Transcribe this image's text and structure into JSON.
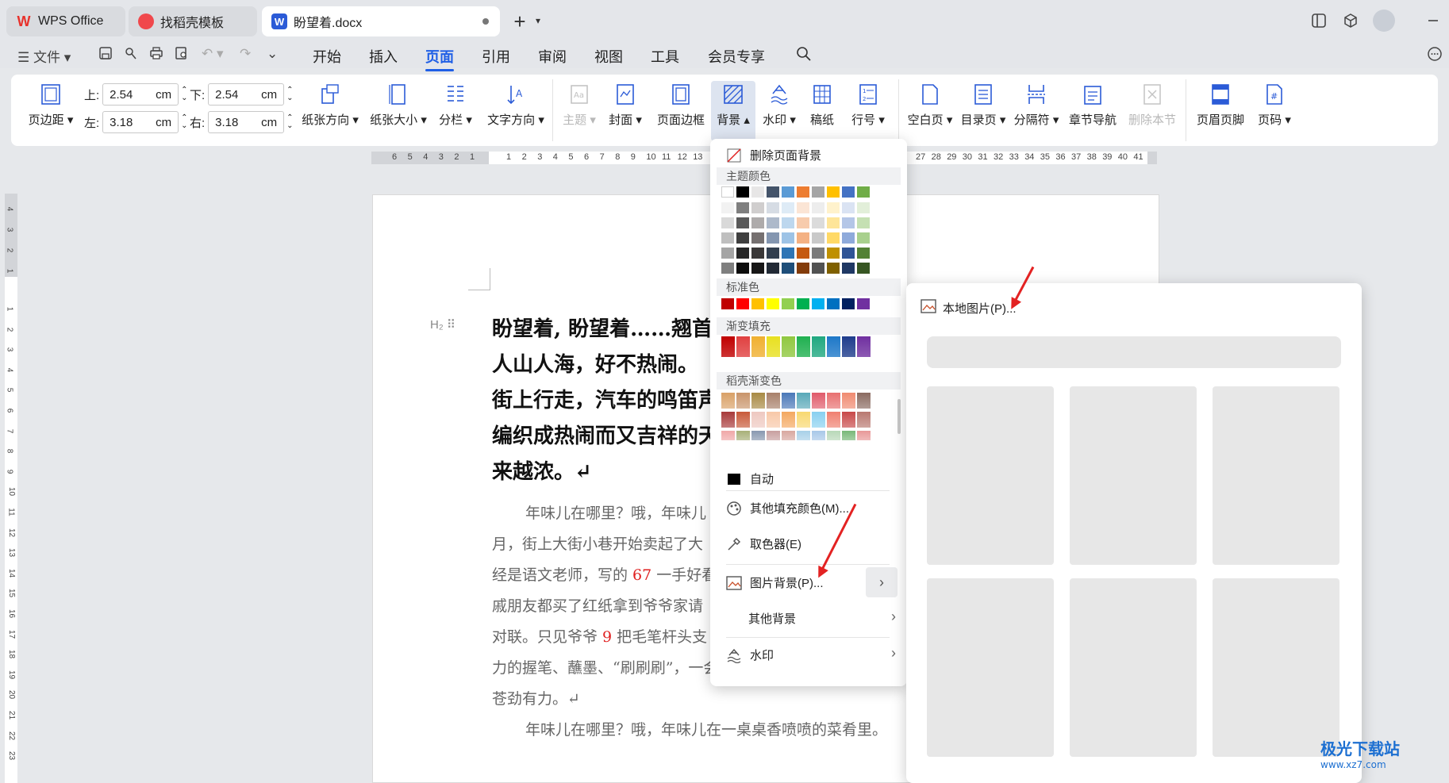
{
  "tabs": [
    {
      "label": "WPS Office",
      "icon": "wps-logo-icon"
    },
    {
      "label": "找稻壳模板",
      "icon": "docer-icon"
    },
    {
      "label": "盼望着.docx",
      "icon": "word-doc-icon"
    }
  ],
  "new_tab_label": "+",
  "menubar": {
    "file_label": "文件",
    "items": [
      "开始",
      "插入",
      "页面",
      "引用",
      "审阅",
      "视图",
      "工具",
      "会员专享"
    ],
    "active": "页面"
  },
  "ribbon": {
    "margins_label": "页边距",
    "top_label": "上:",
    "top_value": "2.54",
    "top_unit": "cm",
    "bottom_label": "下:",
    "bottom_value": "2.54",
    "bottom_unit": "cm",
    "left_label": "左:",
    "left_value": "3.18",
    "left_unit": "cm",
    "right_label": "右:",
    "right_value": "3.18",
    "right_unit": "cm",
    "orientation": "纸张方向",
    "paper_size": "纸张大小",
    "columns": "分栏",
    "text_direction": "文字方向",
    "theme": "主题",
    "cover": "封面",
    "page_border": "页面边框",
    "background": "背景",
    "watermark": "水印",
    "manuscript": "稿纸",
    "line_number": "行号",
    "blank_page": "空白页",
    "toc_page": "目录页",
    "separator": "分隔符",
    "section_nav": "章节导航",
    "delete_section": "删除本节",
    "header_footer": "页眉页脚",
    "page_number": "页码"
  },
  "ruler": {
    "h_gray_left": [
      "6",
      "5",
      "4",
      "3",
      "2",
      "1"
    ],
    "h_white": [
      "1",
      "2",
      "3",
      "4",
      "5",
      "6",
      "7",
      "8",
      "9",
      "10",
      "11",
      "12",
      "13"
    ],
    "h_right": [
      "27",
      "28",
      "29",
      "30",
      "31",
      "32",
      "33",
      "34",
      "35",
      "36",
      "37",
      "38",
      "39",
      "40",
      "41"
    ],
    "v_top": [
      "4",
      "3",
      "2",
      "1"
    ],
    "v_main": [
      "1",
      "2",
      "3",
      "4",
      "5",
      "6",
      "7",
      "8",
      "9",
      "10",
      "11",
      "12",
      "13",
      "14",
      "15",
      "16",
      "17",
      "18",
      "19",
      "20",
      "21",
      "22",
      "23"
    ]
  },
  "document": {
    "heading_lines": [
      "盼望着, 盼望着……翘首",
      "人山人海，好不热闹。",
      "街上行走，汽车的鸣笛声",
      "编织成热闹而又吉祥的天",
      "来越浓。↵"
    ],
    "body_lines": [
      {
        "text": "年味儿在哪里？哦，年味儿",
        "indent": true
      },
      {
        "text": "月，街上大街小巷开始卖起了大",
        "indent": false
      },
      {
        "pre": "经是语文老师，写的 ",
        "num": "67",
        "post": " 一手好看",
        "indent": false
      },
      {
        "text": "戚朋友都买了红纸拿到爷爷家请",
        "indent": false
      },
      {
        "pre": "对联。只见爷爷 ",
        "num": "9",
        "post": " 把毛笔杆头支",
        "indent": false
      },
      {
        "text": "力的握笔、蘸墨、“刷刷刷”，一会儿下功夫，一副副对联",
        "indent": false
      },
      {
        "text": "苍劲有力。↵",
        "indent": false
      },
      {
        "text": "年味儿在哪里？哦，年味儿在一桌桌香喷喷的菜肴里。",
        "indent": true
      }
    ]
  },
  "background_menu": {
    "delete_bg": "删除页面背景",
    "theme_colors": "主题颜色",
    "standard_colors": "标准色",
    "gradient_fill": "渐变填充",
    "docer_gradient": "稻壳渐变色",
    "auto": "自动",
    "more_colors": "其他填充颜色(M)...",
    "eyedropper": "取色器(E)",
    "picture_bg": "图片背景(P)...",
    "other_bg": "其他背景",
    "watermark": "水印"
  },
  "submenu": {
    "local_picture": "本地图片(P)..."
  },
  "colors": {
    "theme_top": [
      "#ffffff",
      "#000000",
      "#e7e6e6",
      "#44546a",
      "#5b9bd5",
      "#ed7d31",
      "#a5a5a5",
      "#ffc000",
      "#4472c4",
      "#70ad47"
    ],
    "theme_shades": [
      [
        "#f2f2f2",
        "#7f7f7f",
        "#d0cece",
        "#d6dce4",
        "#deebf6",
        "#fbe5d5",
        "#ededed",
        "#fff2cc",
        "#dae3f3",
        "#e2efd9"
      ],
      [
        "#d9d9d9",
        "#595959",
        "#aeabab",
        "#adb9ca",
        "#bdd7ee",
        "#f7cbac",
        "#dbdbdb",
        "#fee599",
        "#b4c6e7",
        "#c5e0b3"
      ],
      [
        "#bfbfbf",
        "#3f3f3f",
        "#757070",
        "#8496b0",
        "#9dc3e6",
        "#f4b183",
        "#c9c9c9",
        "#ffd966",
        "#8eaadb",
        "#a8d08d"
      ],
      [
        "#a5a5a5",
        "#262626",
        "#3a3838",
        "#323f4f",
        "#2e75b5",
        "#c55a11",
        "#7b7b7b",
        "#bf9000",
        "#2f5496",
        "#538135"
      ],
      [
        "#7f7f7f",
        "#0c0c0c",
        "#171616",
        "#222a35",
        "#1e4e79",
        "#833c0b",
        "#525252",
        "#7f6000",
        "#1f3864",
        "#375623"
      ]
    ],
    "standard": [
      "#c00000",
      "#ff0000",
      "#ffc000",
      "#ffff00",
      "#92d050",
      "#00b050",
      "#00b0f0",
      "#0070c0",
      "#002060",
      "#7030a0"
    ],
    "gradient": [
      "#c00000",
      "#e04040",
      "#f0b030",
      "#e8e020",
      "#90c840",
      "#20b050",
      "#20a880",
      "#1e78c8",
      "#1e3c8c",
      "#7030a0"
    ],
    "docer": [
      [
        "#d9a066",
        "#c9946a",
        "#a88a44",
        "#a8806a",
        "#4a78b8",
        "#58a8b8",
        "#e05a6a",
        "#e87070",
        "#f08a70",
        "#8a6a60"
      ],
      [
        "#a83a3a",
        "#c85a3a",
        "#eec8c0",
        "#f8c8a8",
        "#f4a860",
        "#f8d870",
        "#88d0f0",
        "#f08070",
        "#c84848",
        "#b87870"
      ],
      [
        "#f0a8a8",
        "#a8b078",
        "#8898b0",
        "#c8a0a0",
        "#d8a8a0",
        "#a8d0e8",
        "#a8c8e8",
        "#b8d8b8",
        "#78b878",
        "#e89898"
      ]
    ],
    "accent": "#1f5fe6",
    "arrow": "#e32222"
  }
}
